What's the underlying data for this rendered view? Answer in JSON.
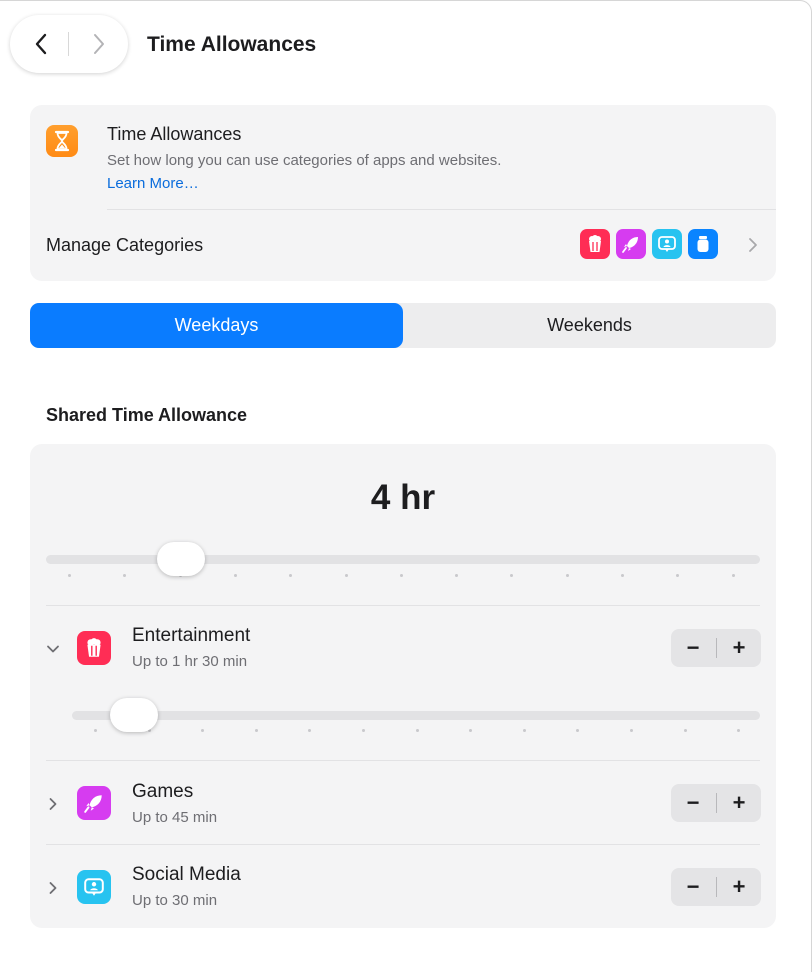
{
  "header": {
    "title": "Time Allowances",
    "back_icon": "chevron-left-icon",
    "forward_icon": "chevron-right-icon"
  },
  "info_card": {
    "icon": "hourglass-icon",
    "icon_color": "#ff9528",
    "title": "Time Allowances",
    "description": "Set how long you can use categories of apps and websites.",
    "link": "Learn More…",
    "manage_label": "Manage Categories",
    "category_icons": [
      {
        "name": "popcorn-icon",
        "color": "#ff2d55"
      },
      {
        "name": "rocket-icon",
        "color": "#d63cf0"
      },
      {
        "name": "chat-person-icon",
        "color": "#27c3f0"
      },
      {
        "name": "jar-icon",
        "color": "#0a84ff"
      }
    ]
  },
  "segmented": {
    "options": [
      "Weekdays",
      "Weekends"
    ],
    "selected": "Weekdays",
    "accent": "#0a7cff"
  },
  "shared": {
    "section_title": "Shared Time Allowance",
    "value": "4 hr"
  },
  "categories": [
    {
      "name": "Entertainment",
      "limit": "Up to 1 hr 30 min",
      "expanded": true,
      "icon": "popcorn-icon",
      "color": "#ff2d55"
    },
    {
      "name": "Games",
      "limit": "Up to 45 min",
      "expanded": false,
      "icon": "rocket-icon",
      "color": "#d63cf0"
    },
    {
      "name": "Social Media",
      "limit": "Up to 30 min",
      "expanded": false,
      "icon": "chat-person-icon",
      "color": "#27c3f0"
    }
  ],
  "stepper": {
    "minus": "−",
    "plus": "+"
  }
}
